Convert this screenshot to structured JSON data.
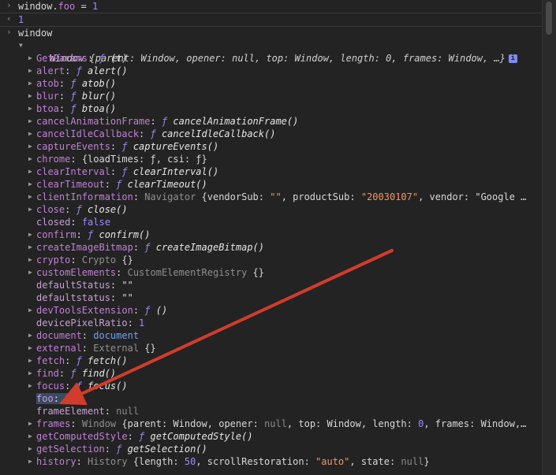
{
  "console": {
    "entries": [
      {
        "type": "input",
        "text_obj": "window.",
        "text_prop": "foo",
        "text_op": " = ",
        "text_val": "1"
      },
      {
        "type": "output",
        "text": "1"
      },
      {
        "type": "input",
        "text": "window"
      }
    ],
    "window_summary": {
      "name": "Window",
      "body": " {parent: Window, opener: null, top: Window, length: 0, frames: Window, …}"
    },
    "properties": [
      {
        "key": "GetParams",
        "sep": ": ",
        "f": "ƒ ",
        "sig": "(t)",
        "expand": true
      },
      {
        "key": "alert",
        "sep": ": ",
        "f": "ƒ ",
        "sig": "alert()",
        "expand": true
      },
      {
        "key": "atob",
        "sep": ": ",
        "f": "ƒ ",
        "sig": "atob()",
        "expand": true
      },
      {
        "key": "blur",
        "sep": ": ",
        "f": "ƒ ",
        "sig": "blur()",
        "expand": true
      },
      {
        "key": "btoa",
        "sep": ": ",
        "f": "ƒ ",
        "sig": "btoa()",
        "expand": true
      },
      {
        "key": "cancelAnimationFrame",
        "sep": ": ",
        "f": "ƒ ",
        "sig": "cancelAnimationFrame()",
        "expand": true
      },
      {
        "key": "cancelIdleCallback",
        "sep": ": ",
        "f": "ƒ ",
        "sig": "cancelIdleCallback()",
        "expand": true
      },
      {
        "key": "captureEvents",
        "sep": ": ",
        "f": "ƒ ",
        "sig": "captureEvents()",
        "expand": true
      },
      {
        "key": "chrome",
        "sep": ": ",
        "value": "{loadTimes: ƒ, csi: ƒ}",
        "expand": true
      },
      {
        "key": "clearInterval",
        "sep": ": ",
        "f": "ƒ ",
        "sig": "clearInterval()",
        "expand": true
      },
      {
        "key": "clearTimeout",
        "sep": ": ",
        "f": "ƒ ",
        "sig": "clearTimeout()",
        "expand": true
      },
      {
        "key": "clientInformation",
        "sep": ": ",
        "value": "Navigator {vendorSub: \"\", productSub: \"20030107\", vendor: \"Google …",
        "expand": true
      },
      {
        "key": "close",
        "sep": ": ",
        "f": "ƒ ",
        "sig": "close()",
        "expand": true
      },
      {
        "key": "closed",
        "sep": ": ",
        "value": "false",
        "expand": false
      },
      {
        "key": "confirm",
        "sep": ": ",
        "f": "ƒ ",
        "sig": "confirm()",
        "expand": true
      },
      {
        "key": "createImageBitmap",
        "sep": ": ",
        "f": "ƒ ",
        "sig": "createImageBitmap()",
        "expand": true
      },
      {
        "key": "crypto",
        "sep": ": ",
        "value": "Crypto {}",
        "expand": true
      },
      {
        "key": "customElements",
        "sep": ": ",
        "value": "CustomElementRegistry {}",
        "expand": true
      },
      {
        "key": "defaultStatus",
        "sep": ": ",
        "value": "\"\"",
        "expand": false
      },
      {
        "key": "defaultstatus",
        "sep": ": ",
        "value": "\"\"",
        "expand": false
      },
      {
        "key": "devToolsExtension",
        "sep": ": ",
        "f": "ƒ ",
        "sig": "()",
        "expand": true
      },
      {
        "key": "devicePixelRatio",
        "sep": ": ",
        "value": "1",
        "expand": false
      },
      {
        "key": "document",
        "sep": ": ",
        "value": "document",
        "expand": true
      },
      {
        "key": "external",
        "sep": ": ",
        "value": "External {}",
        "expand": true
      },
      {
        "key": "fetch",
        "sep": ": ",
        "f": "ƒ ",
        "sig": "fetch()",
        "expand": true
      },
      {
        "key": "find",
        "sep": ": ",
        "f": "ƒ ",
        "sig": "find()",
        "expand": true
      },
      {
        "key": "focus",
        "sep": ": ",
        "f": "ƒ ",
        "sig": "focus()",
        "expand": true
      },
      {
        "key": "foo",
        "sep": ": ",
        "value": "1",
        "expand": false,
        "highlight": true
      },
      {
        "key": "frameElement",
        "sep": ": ",
        "value": "null",
        "expand": false
      },
      {
        "key": "frames",
        "sep": ": ",
        "value": "Window {parent: Window, opener: null, top: Window, length: 0, frames: Window,…",
        "expand": true
      },
      {
        "key": "getComputedStyle",
        "sep": ": ",
        "f": "ƒ ",
        "sig": "getComputedStyle()",
        "expand": true
      },
      {
        "key": "getSelection",
        "sep": ": ",
        "f": "ƒ ",
        "sig": "getSelection()",
        "expand": true
      },
      {
        "key": "history",
        "sep": ": ",
        "value": "History {length: 50, scrollRestoration: \"auto\", state: null}",
        "expand": true
      }
    ]
  },
  "annotation": {
    "arrow_color": "#d23c2c"
  }
}
